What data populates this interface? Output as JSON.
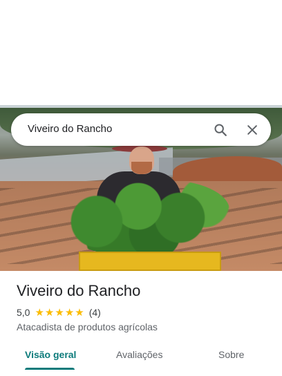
{
  "search": {
    "query": "Viveiro do Rancho"
  },
  "icons": {
    "search": "search-icon",
    "close": "close-icon",
    "star": "star-icon"
  },
  "place": {
    "title": "Viveiro do Rancho",
    "rating": "5,0",
    "stars": 5,
    "star_glyph": "★",
    "review_count": "(4)",
    "category": "Atacadista de produtos agrícolas"
  },
  "tabs": [
    {
      "label": "Visão geral",
      "active": true
    },
    {
      "label": "Avaliações",
      "active": false
    },
    {
      "label": "Sobre",
      "active": false
    }
  ],
  "colors": {
    "accent": "#0b7a7a",
    "star": "#fbbc04"
  }
}
